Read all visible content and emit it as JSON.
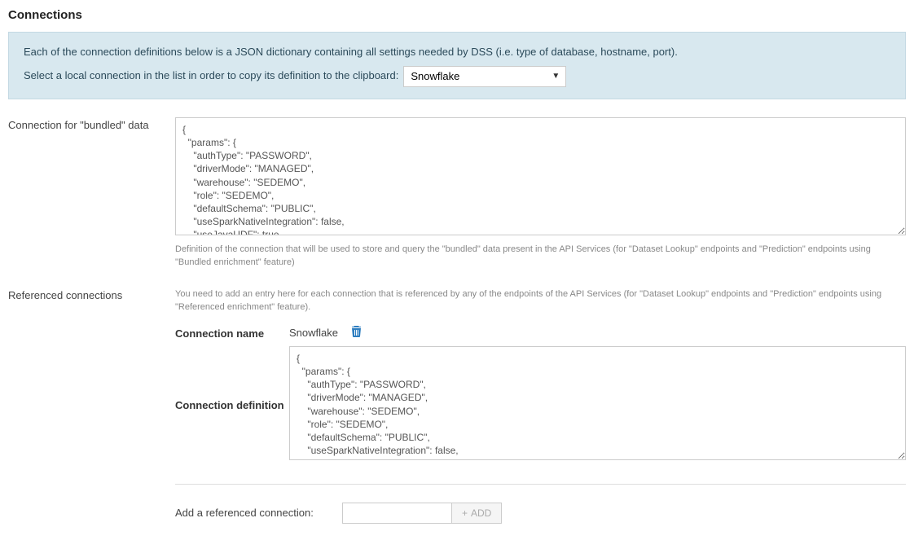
{
  "page_title": "Connections",
  "info": {
    "line1": "Each of the connection definitions below is a JSON dictionary containing all settings needed by DSS (i.e. type of database, hostname, port).",
    "line2_prefix": "Select a local connection in the list in order to copy its definition to the clipboard:",
    "select_value": "Snowflake"
  },
  "bundled": {
    "label": "Connection for \"bundled\" data",
    "json": "{\n  \"params\": {\n    \"authType\": \"PASSWORD\",\n    \"driverMode\": \"MANAGED\",\n    \"warehouse\": \"SEDEMO\",\n    \"role\": \"SEDEMO\",\n    \"defaultSchema\": \"PUBLIC\",\n    \"useSparkNativeIntegration\": false,\n    \"useJavaUDF\": true,\n    \"javaUDFStage\": \"PUBLIC.JAVA_UDF_STAGE\",",
    "helper": "Definition of the connection that will be used to store and query the \"bundled\" data present in the API Services (for \"Dataset Lookup\" endpoints and \"Prediction\" endpoints using \"Bundled enrichment\" feature)"
  },
  "referenced": {
    "label": "Referenced connections",
    "helper": "You need to add an entry here for each connection that is referenced by any of the endpoints of the API Services (for \"Dataset Lookup\" endpoints and \"Prediction\" endpoints using \"Referenced enrichment\" feature).",
    "name_label": "Connection name",
    "name_value": "Snowflake",
    "def_label": "Connection definition",
    "json": "{\n  \"params\": {\n    \"authType\": \"PASSWORD\",\n    \"driverMode\": \"MANAGED\",\n    \"warehouse\": \"SEDEMO\",\n    \"role\": \"SEDEMO\",\n    \"defaultSchema\": \"PUBLIC\",\n    \"useSparkNativeIntegration\": false,\n    \"useJavaUDF\": true,\n    \"javaUDFStage\": \"PUBLIC.JAVA_UDF_STAGE\","
  },
  "add": {
    "label": "Add a referenced connection:",
    "input_value": "",
    "button": "ADD"
  }
}
